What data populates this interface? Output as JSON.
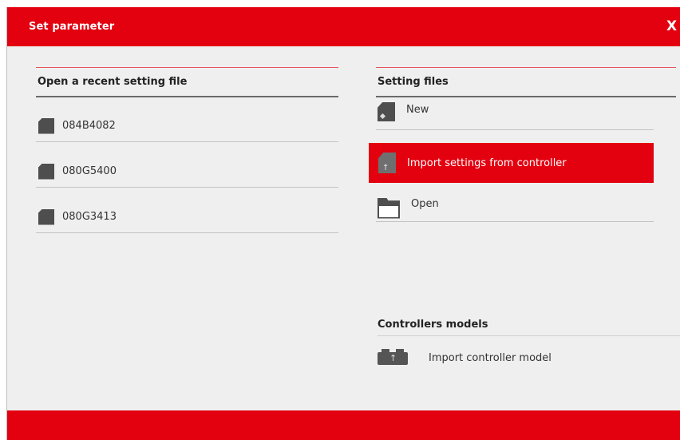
{
  "window": {
    "title": "Set parameter",
    "close_label": "X"
  },
  "recent": {
    "heading": "Open a recent setting file",
    "items": [
      {
        "label": "084B4082"
      },
      {
        "label": "080G5400"
      },
      {
        "label": "080G3413"
      }
    ]
  },
  "setting_files": {
    "heading": "Setting files",
    "new_label": "New",
    "import_label": "Import settings from controller",
    "open_label": "Open"
  },
  "controllers": {
    "heading": "Controllers models",
    "import_label": "Import controller model"
  },
  "colors": {
    "accent": "#e3000f",
    "panel_bg": "#efefef",
    "icon": "#4e4e4e"
  }
}
